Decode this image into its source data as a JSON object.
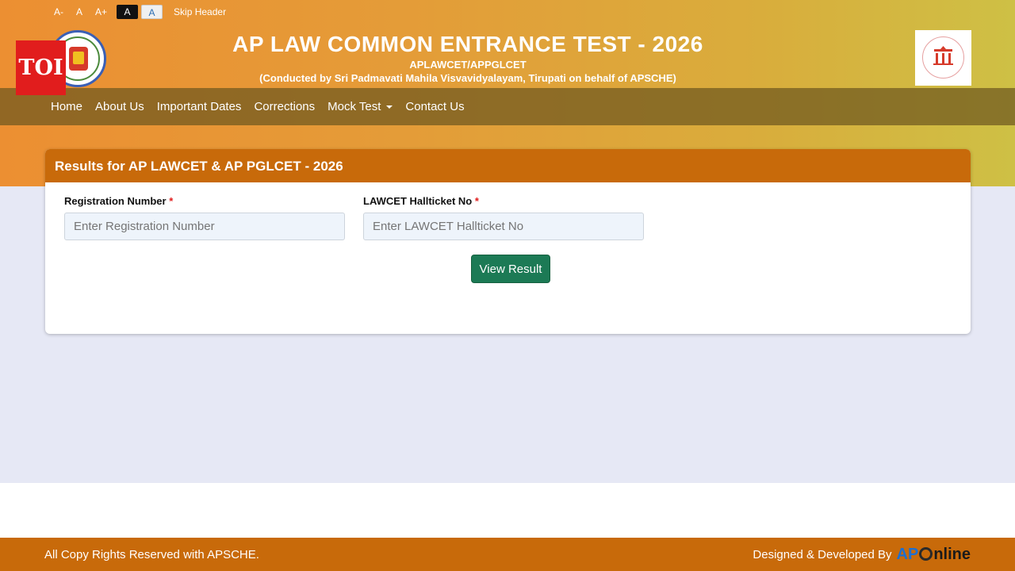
{
  "accessibility": {
    "font_decrease": "A-",
    "font_normal": "A",
    "font_increase": "A+",
    "theme_dark": "A",
    "theme_light": "A",
    "skip_header": "Skip Header"
  },
  "watermark": "TOI",
  "header": {
    "title": "AP LAW COMMON ENTRANCE TEST - 2026",
    "subtitle": "APLAWCET/APPGLCET",
    "conducted_by": "(Conducted by Sri Padmavati Mahila Visvavidyalayam, Tirupati on behalf of APSCHE)"
  },
  "nav": {
    "items": [
      {
        "label": "Home"
      },
      {
        "label": "About Us"
      },
      {
        "label": "Important Dates"
      },
      {
        "label": "Corrections"
      },
      {
        "label": "Mock Test"
      },
      {
        "label": "Contact Us"
      }
    ]
  },
  "card": {
    "title": "Results for AP LAWCET & AP PGLCET - 2026",
    "fields": [
      {
        "label": "Registration Number",
        "required_mark": "*",
        "placeholder": "Enter Registration Number",
        "value": ""
      },
      {
        "label": "LAWCET Hallticket No",
        "required_mark": "*",
        "placeholder": "Enter LAWCET Hallticket No",
        "value": ""
      }
    ],
    "submit_label": "View Result"
  },
  "footer": {
    "copyright": "All Copy Rights Reserved with APSCHE.",
    "designed_by": "Designed & Developed By",
    "brand_ap": "AP",
    "brand_rest": "nline"
  },
  "colors": {
    "header_orange": "#ec8f32",
    "card_header": "#c86a0a",
    "button_green": "#1c7a55",
    "page_bg": "#e6e8f5"
  },
  "icons": [
    "university-emblem-icon",
    "apsche-logo-icon",
    "caret-down-icon"
  ]
}
